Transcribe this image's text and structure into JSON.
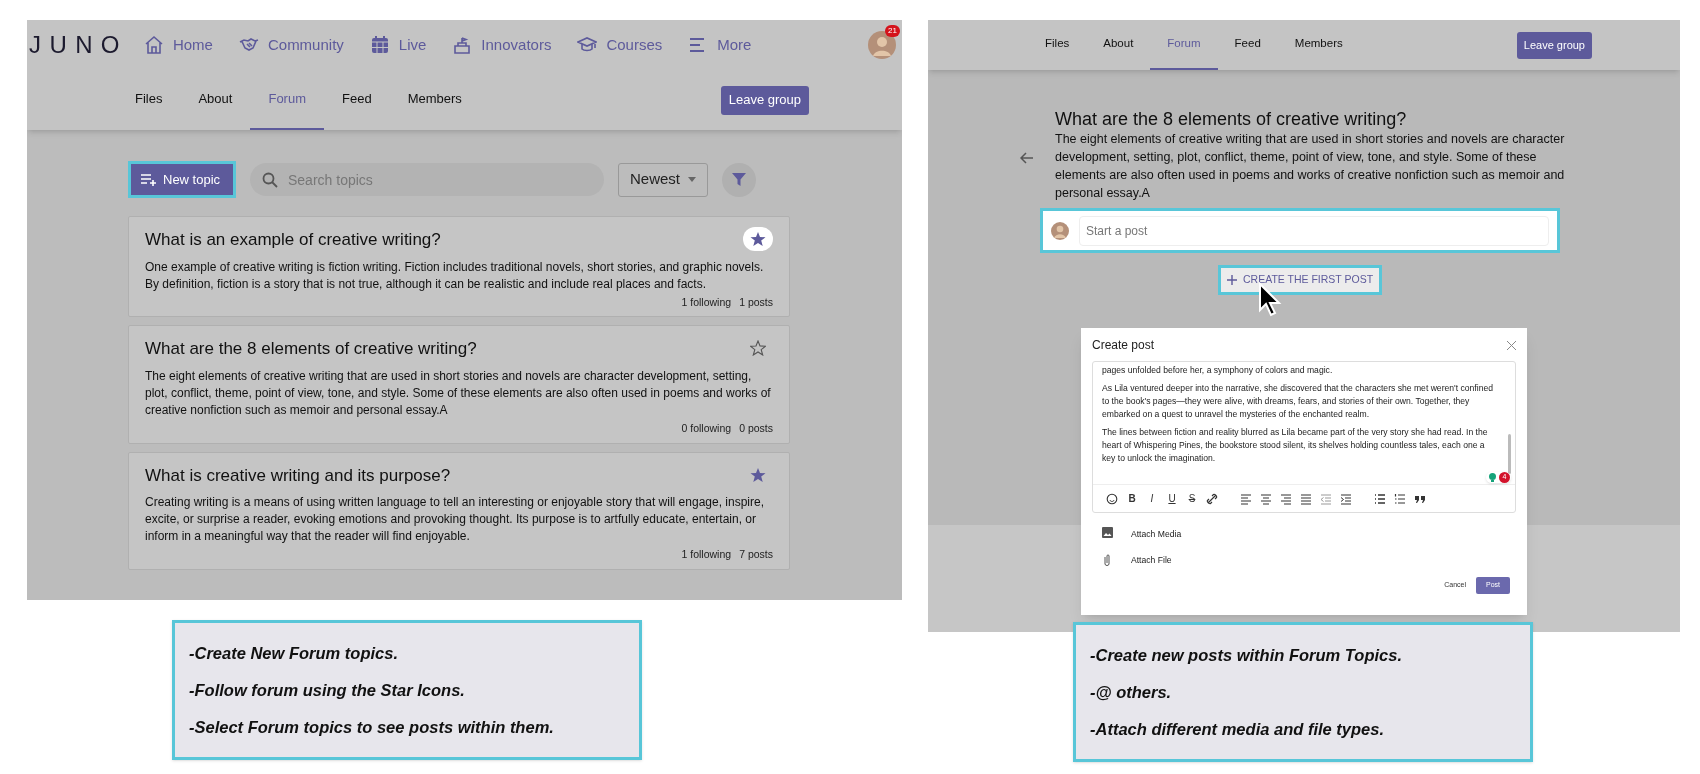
{
  "forum_screen": {
    "logo": "JUNO",
    "nav": [
      {
        "kind": "home",
        "label": "Home"
      },
      {
        "kind": "handshake",
        "label": "Community"
      },
      {
        "kind": "calendar",
        "label": "Live"
      },
      {
        "kind": "podium",
        "label": "Innovators"
      },
      {
        "kind": "cap",
        "label": "Courses"
      },
      {
        "kind": "menu",
        "label": "More"
      }
    ],
    "notification_count": "21",
    "tabs": [
      {
        "label": "Files",
        "selected": false
      },
      {
        "label": "About",
        "selected": false
      },
      {
        "label": "Forum",
        "selected": true
      },
      {
        "label": "Feed",
        "selected": false
      },
      {
        "label": "Members",
        "selected": false
      }
    ],
    "leave_button": "Leave group",
    "new_topic_button": "New topic",
    "search": {
      "placeholder": "Search topics"
    },
    "sort": "Newest",
    "topics": [
      {
        "title": "What is an example of creative writing?",
        "body": "One example of creative writing is fiction writing. Fiction includes traditional novels, short stories, and graphic novels. By definition, fiction is a story that is not true, although it can be realistic and include real places and facts.",
        "following": "1 following",
        "posts": "1 posts",
        "starred": true,
        "hovered": true
      },
      {
        "title": "What are the 8 elements of creative writing?",
        "body": "The eight elements of creative writing that are used in short stories and novels are character development, setting, plot, conflict, theme, point of view, tone, and style. Some of these elements are also often used in poems and works of creative nonfiction such as memoir and personal essay.A",
        "following": "0 following",
        "posts": "0 posts",
        "starred": false,
        "hovered": false
      },
      {
        "title": "What is creative writing and its purpose?",
        "body": "Creating writing is a means of using written language to tell an interesting or enjoyable story that will engage, inspire, excite, or surprise a reader, evoking emotions and provoking thought. Its purpose is to artfully educate, entertain, or inform in a meaningful way that the reader will find enjoyable.",
        "following": "1 following",
        "posts": "7 posts",
        "starred": true,
        "hovered": false
      }
    ]
  },
  "forum_caption": [
    "-Create New Forum topics.",
    "-Follow forum using the Star Icons.",
    "-Select Forum topics to see posts within them."
  ],
  "topic_screen": {
    "tabs": [
      {
        "label": "Files",
        "selected": false
      },
      {
        "label": "About",
        "selected": false
      },
      {
        "label": "Forum",
        "selected": true
      },
      {
        "label": "Feed",
        "selected": false
      },
      {
        "label": "Members",
        "selected": false
      }
    ],
    "leave_button": "Leave group",
    "topic_title": "What are the 8 elements of creative writing?",
    "topic_body": "The eight elements of creative writing that are used in short stories and novels are character development, setting, plot, conflict, theme, point of view, tone, and style. Some of these elements are also often used in poems and works of creative nonfiction such as memoir and personal essay.A",
    "post_field": {
      "placeholder": "Start a post"
    },
    "create_button": "CREATE THE FIRST POST",
    "dialog": {
      "title": "Create post",
      "paragraphs": [
        "pages unfolded before her, a symphony of colors and magic.",
        "As Lila ventured deeper into the narrative, she discovered that the characters she met weren't confined to the book's pages—they were alive, with dreams, fears, and stories of their own. Together, they embarked on a quest to unravel the mysteries of the enchanted realm.",
        "The lines between fiction and reality blurred as Lila became part of the very story she had read. In the heart of Whispering Pines, the bookstore stood silent, its shelves holding countless tales, each one a key to unlock the imagination."
      ],
      "issue_count": "4",
      "toolbar": [
        {
          "kind": "emoji"
        },
        {
          "kind": "glyph",
          "label": "B"
        },
        {
          "kind": "glyph",
          "label": "I"
        },
        {
          "kind": "glyph",
          "label": "U"
        },
        {
          "kind": "glyph",
          "label": "S"
        },
        {
          "kind": "link"
        },
        {
          "kind": "align-left"
        },
        {
          "kind": "align-center"
        },
        {
          "kind": "align-right"
        },
        {
          "kind": "justify"
        },
        {
          "kind": "outdent"
        },
        {
          "kind": "indent"
        },
        {
          "kind": "bullets"
        },
        {
          "kind": "numbers"
        },
        {
          "kind": "quote"
        }
      ],
      "attachments": [
        {
          "kind": "media",
          "label": "Attach Media"
        },
        {
          "kind": "file",
          "label": "Attach File"
        }
      ],
      "cancel_button": "Cancel",
      "post_button": "Post"
    }
  },
  "topic_caption": [
    "-Create new posts within Forum Topics.",
    "-@ others.",
    "-Attach different media and file types."
  ]
}
